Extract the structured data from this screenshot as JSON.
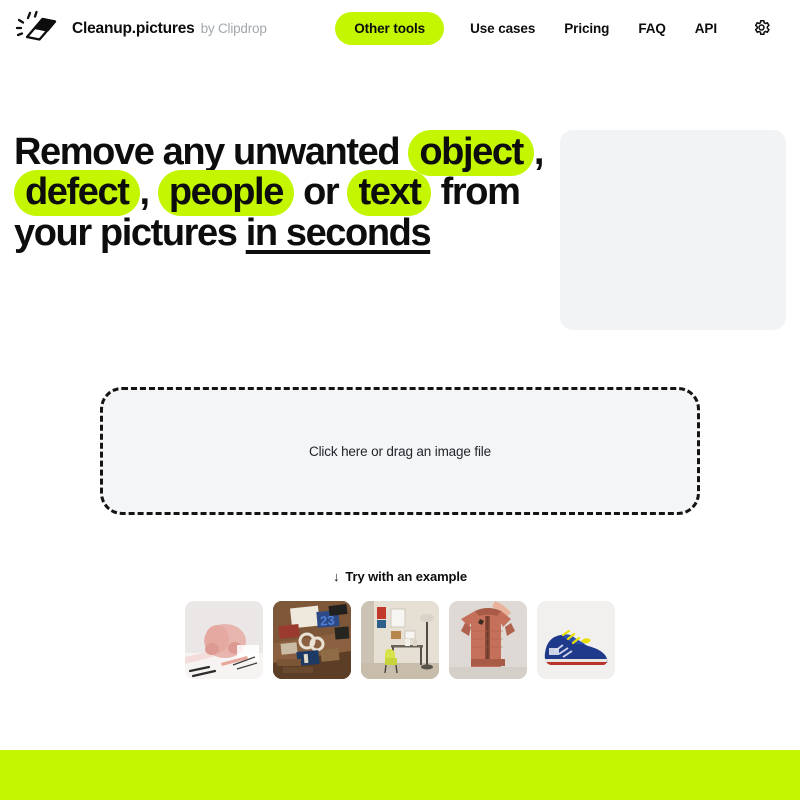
{
  "header": {
    "logo_icon": "eraser-sparkle-icon",
    "brand_name": "Cleanup.pictures",
    "brand_by": "by Clipdrop",
    "nav": {
      "primary_label": "Other tools",
      "links": [
        {
          "label": "Use cases"
        },
        {
          "label": "Pricing"
        },
        {
          "label": "FAQ"
        },
        {
          "label": "API"
        }
      ],
      "settings_icon": "gear-icon"
    }
  },
  "hero": {
    "headline": {
      "part1": "Remove any unwanted",
      "highlight1": "object",
      "sep1": ",",
      "highlight2": "defect",
      "sep2": ",",
      "highlight3": "people",
      "connector": "or",
      "highlight4": "text",
      "part2": "from your pictures",
      "underlined": "in seconds"
    },
    "media_placeholder": ""
  },
  "dropzone": {
    "label": "Click here or drag an image file"
  },
  "examples": {
    "arrow": "↓",
    "label": "Try with an example",
    "thumbnails": [
      {
        "name": "pink-backpack-example",
        "alt": "Pink backpack on white desk with pencils"
      },
      {
        "name": "wooden-desk-example",
        "alt": "Wooden desk flatlay with notebooks and tools"
      },
      {
        "name": "yellow-chair-room-example",
        "alt": "Room with yellow chair, desk and floor lamp"
      },
      {
        "name": "orange-jacket-example",
        "alt": "Rust orange bomber jacket on hanger"
      },
      {
        "name": "blue-sneaker-example",
        "alt": "Blue sneaker with yellow laces and red sole"
      }
    ]
  },
  "colors": {
    "accent_green": "#c3f600",
    "panel_gray": "#f2f3f5",
    "dropzone_gray": "#f4f5f7",
    "text_dark": "#0d0d0d",
    "muted_text": "#a3a8ae"
  },
  "footer": {
    "band_color": "#c3f600"
  }
}
